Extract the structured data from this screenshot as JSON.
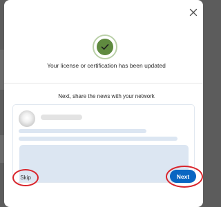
{
  "modal": {
    "headline": "Your license or certification has been updated",
    "share_prompt": "Next, share the news with your network"
  },
  "actions": {
    "skip_label": "Skip",
    "next_label": "Next"
  },
  "icons": {
    "close": "close-icon",
    "success": "checkmark-icon"
  },
  "colors": {
    "primary": "#0a66c2",
    "success": "#5f8a3f",
    "annotation": "#d9242b"
  }
}
